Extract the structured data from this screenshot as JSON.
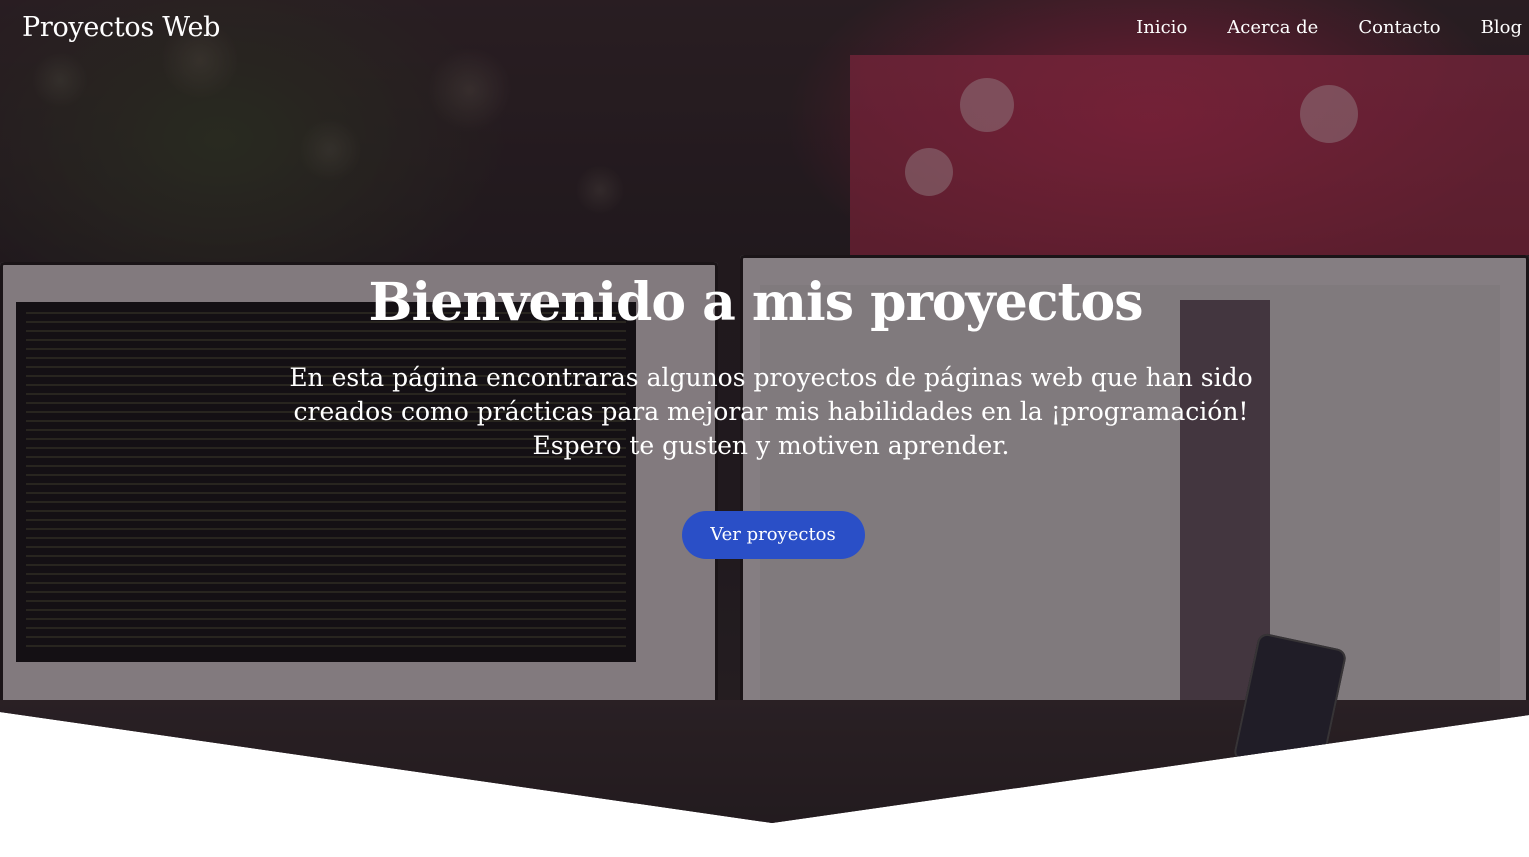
{
  "nav": {
    "brand": "Proyectos Web",
    "links": [
      "Inicio",
      "Acerca de",
      "Contacto",
      "Blog"
    ]
  },
  "hero": {
    "title": "Bienvenido a mis proyectos",
    "subtitle": "En esta página encontraras algunos proyectos de páginas web que han sido creados como prácticas para mejorar mis habilidades en la ¡programación! Espero te gusten y motiven aprender.",
    "cta_label": "Ver proyectos"
  },
  "colors": {
    "cta_background": "#2a4fc7",
    "text": "#ffffff",
    "page_background": "#ffffff"
  }
}
